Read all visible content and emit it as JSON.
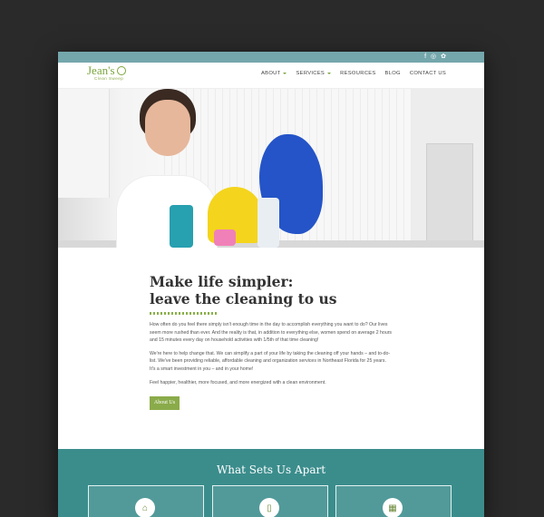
{
  "social": {
    "facebook_icon": "f",
    "instagram_icon": "◎",
    "pinterest_icon": "✿"
  },
  "logo": {
    "name": "Jean's",
    "tagline": "Clean Sweep"
  },
  "nav": {
    "items": [
      {
        "label": "ABOUT",
        "has_dropdown": true
      },
      {
        "label": "SERVICES",
        "has_dropdown": true
      },
      {
        "label": "RESOURCES",
        "has_dropdown": false
      },
      {
        "label": "BLOG",
        "has_dropdown": false
      },
      {
        "label": "CONTACT US",
        "has_dropdown": false
      }
    ]
  },
  "main": {
    "heading_line1": "Make life simpler:",
    "heading_line2": "leave the cleaning to us",
    "paragraphs": [
      "How often do you feel there simply isn't enough time in the day to accomplish everything you want to do? Our lives seem more rushed than ever. And the reality is that, in addition to everything else, women spend on average 2 hours and 15 minutes every day on household activities with 1/5th of that time cleaning!",
      "We're here to help change that. We can simplify a part of your life by taking the cleaning off your hands – and to-do-list. We've been providing reliable, affordable cleaning and organization services in Northeast Florida for 25 years. It's a smart investment in you – and in your home!",
      "Feel happier, healthier, more focused, and more energized with a clean environment."
    ],
    "button_label": "About Us"
  },
  "apart": {
    "title": "What Sets Us Apart",
    "cards": [
      {
        "icon": "home-icon",
        "glyph": "⌂"
      },
      {
        "icon": "phone-icon",
        "glyph": "▯"
      },
      {
        "icon": "calendar-icon",
        "glyph": "▦"
      }
    ]
  },
  "colors": {
    "accent_green": "#8aab4a",
    "teal": "#3b8d8c",
    "topbar": "#74a7ac"
  }
}
